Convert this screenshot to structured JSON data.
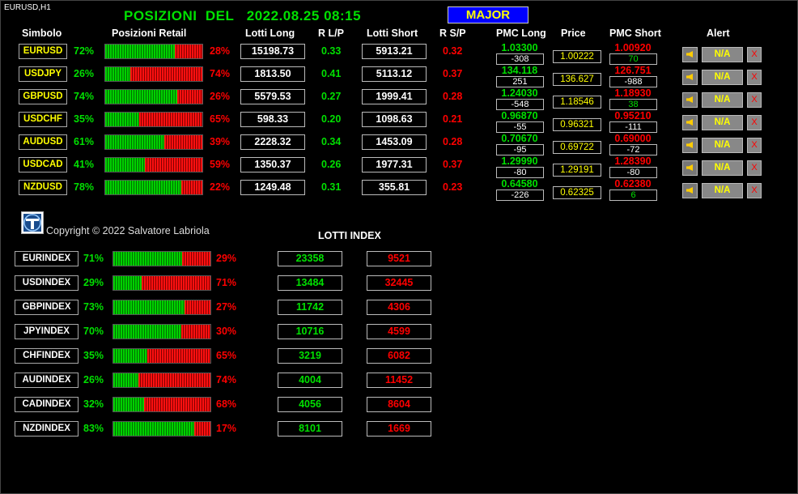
{
  "chart_label": "EURUSD,H1",
  "title": "POSIZIONI  DEL   2022.08.25 08:15",
  "group_button": "MAJOR",
  "headers": {
    "simbolo": "Simbolo",
    "posizioni_retail": "Posizioni Retail",
    "lotti_long": "Lotti Long",
    "r_lp": "R L/P",
    "lotti_short": "Lotti Short",
    "r_sp": "R S/P",
    "pmc_long": "PMC Long",
    "price": "Price",
    "pmc_short": "PMC Short",
    "alert": "Alert"
  },
  "pairs": [
    {
      "symbol": "EURUSD",
      "long_pct": "72%",
      "long_frac": 0.72,
      "short_pct": "28%",
      "lotti_long": "15198.73",
      "r_lp": "0.33",
      "lotti_short": "5913.21",
      "r_sp": "0.32",
      "pmc_long": "1.03300",
      "pmc_long_diff": "-308",
      "price": "1.00222",
      "pmc_short": "1.00920",
      "pmc_short_diff": "70",
      "alert": "N/A",
      "close": "X"
    },
    {
      "symbol": "USDJPY",
      "long_pct": "26%",
      "long_frac": 0.26,
      "short_pct": "74%",
      "lotti_long": "1813.50",
      "r_lp": "0.41",
      "lotti_short": "5113.12",
      "r_sp": "0.37",
      "pmc_long": "134.118",
      "pmc_long_diff": "251",
      "price": "136.627",
      "pmc_short": "126.751",
      "pmc_short_diff": "-988",
      "alert": "N/A",
      "close": "X"
    },
    {
      "symbol": "GBPUSD",
      "long_pct": "74%",
      "long_frac": 0.74,
      "short_pct": "26%",
      "lotti_long": "5579.53",
      "r_lp": "0.27",
      "lotti_short": "1999.41",
      "r_sp": "0.28",
      "pmc_long": "1.24030",
      "pmc_long_diff": "-548",
      "price": "1.18546",
      "pmc_short": "1.18930",
      "pmc_short_diff": "38",
      "alert": "N/A",
      "close": "X"
    },
    {
      "symbol": "USDCHF",
      "long_pct": "35%",
      "long_frac": 0.35,
      "short_pct": "65%",
      "lotti_long": "598.33",
      "r_lp": "0.20",
      "lotti_short": "1098.63",
      "r_sp": "0.21",
      "pmc_long": "0.96870",
      "pmc_long_diff": "-55",
      "price": "0.96321",
      "pmc_short": "0.95210",
      "pmc_short_diff": "-111",
      "alert": "N/A",
      "close": "X"
    },
    {
      "symbol": "AUDUSD",
      "long_pct": "61%",
      "long_frac": 0.61,
      "short_pct": "39%",
      "lotti_long": "2228.32",
      "r_lp": "0.34",
      "lotti_short": "1453.09",
      "r_sp": "0.28",
      "pmc_long": "0.70670",
      "pmc_long_diff": "-95",
      "price": "0.69722",
      "pmc_short": "0.69000",
      "pmc_short_diff": "-72",
      "alert": "N/A",
      "close": "X"
    },
    {
      "symbol": "USDCAD",
      "long_pct": "41%",
      "long_frac": 0.41,
      "short_pct": "59%",
      "lotti_long": "1350.37",
      "r_lp": "0.26",
      "lotti_short": "1977.31",
      "r_sp": "0.37",
      "pmc_long": "1.29990",
      "pmc_long_diff": "-80",
      "price": "1.29191",
      "pmc_short": "1.28390",
      "pmc_short_diff": "-80",
      "alert": "N/A",
      "close": "X"
    },
    {
      "symbol": "NZDUSD",
      "long_pct": "78%",
      "long_frac": 0.78,
      "short_pct": "22%",
      "lotti_long": "1249.48",
      "r_lp": "0.31",
      "lotti_short": "355.81",
      "r_sp": "0.23",
      "pmc_long": "0.64580",
      "pmc_long_diff": "-226",
      "price": "0.62325",
      "pmc_short": "0.62380",
      "pmc_short_diff": "6",
      "alert": "N/A",
      "close": "X"
    }
  ],
  "copyright": "Copyright © 2022 Salvatore Labriola",
  "lotti_index_title": "LOTTI INDEX",
  "indexes": [
    {
      "name": "EURINDEX",
      "long_pct": "71%",
      "long_frac": 0.71,
      "short_pct": "29%",
      "lotti_long": "23358",
      "lotti_short": "9521"
    },
    {
      "name": "USDINDEX",
      "long_pct": "29%",
      "long_frac": 0.29,
      "short_pct": "71%",
      "lotti_long": "13484",
      "lotti_short": "32445"
    },
    {
      "name": "GBPINDEX",
      "long_pct": "73%",
      "long_frac": 0.73,
      "short_pct": "27%",
      "lotti_long": "11742",
      "lotti_short": "4306"
    },
    {
      "name": "JPYINDEX",
      "long_pct": "70%",
      "long_frac": 0.7,
      "short_pct": "30%",
      "lotti_long": "10716",
      "lotti_short": "4599"
    },
    {
      "name": "CHFINDEX",
      "long_pct": "35%",
      "long_frac": 0.35,
      "short_pct": "65%",
      "lotti_long": "3219",
      "lotti_short": "6082"
    },
    {
      "name": "AUDINDEX",
      "long_pct": "26%",
      "long_frac": 0.26,
      "short_pct": "74%",
      "lotti_long": "4004",
      "lotti_short": "11452"
    },
    {
      "name": "CADINDEX",
      "long_pct": "32%",
      "long_frac": 0.32,
      "short_pct": "68%",
      "lotti_long": "4056",
      "lotti_short": "8604"
    },
    {
      "name": "NZDINDEX",
      "long_pct": "83%",
      "long_frac": 0.83,
      "short_pct": "17%",
      "lotti_long": "8101",
      "lotti_short": "1669"
    }
  ],
  "colors": {
    "long": "#00e000",
    "short": "#ff0000",
    "symbol": "#ffff00",
    "button": "#0000ff"
  }
}
